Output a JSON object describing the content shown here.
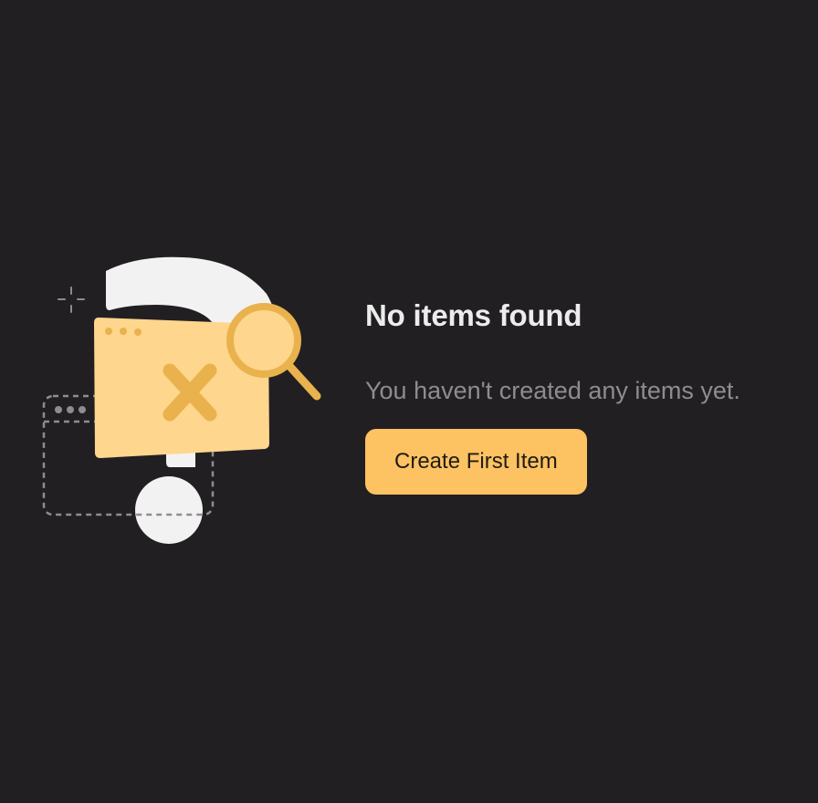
{
  "empty_state": {
    "title": "No items found",
    "message": "You haven't created any items yet.",
    "cta_label": "Create First Item"
  },
  "illustration": {
    "icons": [
      "sparkle-icon",
      "question-mark-icon",
      "browser-window-icon",
      "folder-icon",
      "x-mark-icon",
      "magnifier-icon"
    ]
  },
  "colors": {
    "background": "#221f23",
    "accent": "#fdc262",
    "accent_dark": "#e9b24d",
    "folder": "#fed68e",
    "title": "#ececec",
    "message": "#8f8c91"
  }
}
